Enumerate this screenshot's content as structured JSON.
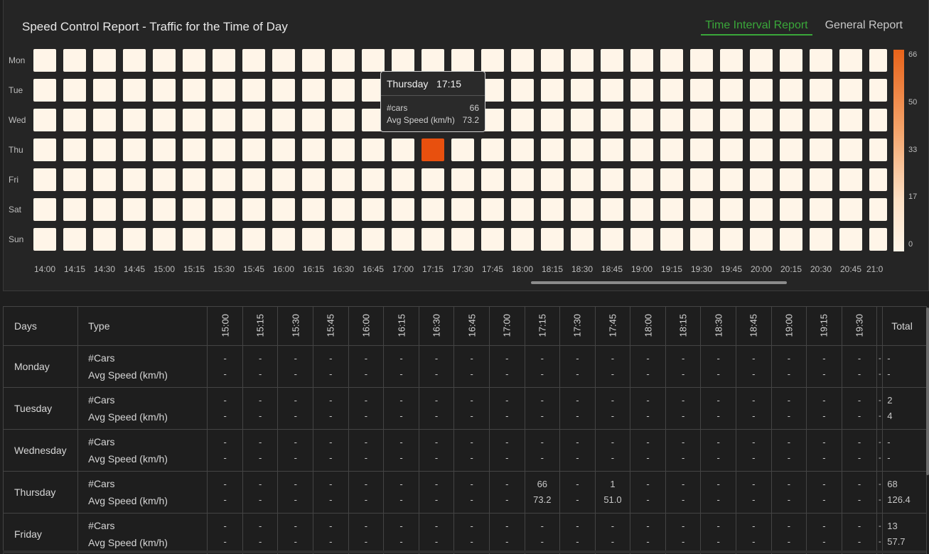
{
  "header": {
    "title": "Speed Control Report - Traffic for the Time of Day",
    "tabs": [
      {
        "label": "Time Interval Report",
        "active": true
      },
      {
        "label": "General Report",
        "active": false
      }
    ]
  },
  "colors": {
    "accent": "#3aa83a",
    "heat_high": "#e8500e",
    "heat_low": "#fff5e8"
  },
  "chart_data": {
    "type": "heatmap",
    "days": [
      "Mon",
      "Tue",
      "Wed",
      "Thu",
      "Fri",
      "Sat",
      "Sun"
    ],
    "times": [
      "14:00",
      "14:15",
      "14:30",
      "14:45",
      "15:00",
      "15:15",
      "15:30",
      "15:45",
      "16:00",
      "16:15",
      "16:30",
      "16:45",
      "17:00",
      "17:15",
      "17:30",
      "17:45",
      "18:00",
      "18:15",
      "18:30",
      "18:45",
      "19:00",
      "19:15",
      "19:30",
      "19:45",
      "20:00",
      "20:15",
      "20:30",
      "20:45",
      "21:0"
    ],
    "values": [
      {
        "day": "Thu",
        "time": "17:15",
        "value": 66
      }
    ],
    "legend_ticks": [
      "66",
      "50",
      "33",
      "17",
      "0"
    ],
    "range": [
      0,
      66
    ]
  },
  "tooltip": {
    "day": "Thursday",
    "time": "17:15",
    "rows": [
      {
        "label": "#cars",
        "value": "66"
      },
      {
        "label": "Avg Speed (km/h)",
        "value": "73.2"
      }
    ]
  },
  "table": {
    "headers": {
      "days": "Days",
      "type": "Type",
      "total": "Total"
    },
    "time_columns": [
      "15:00",
      "15:15",
      "15:30",
      "15:45",
      "16:00",
      "16:15",
      "16:30",
      "16:45",
      "17:00",
      "17:15",
      "17:30",
      "17:45",
      "18:00",
      "18:15",
      "18:30",
      "18:45",
      "19:00",
      "19:15",
      "19:30"
    ],
    "type_labels": [
      "#Cars",
      "Avg Speed (km/h)"
    ],
    "rows": [
      {
        "day": "Monday",
        "cars": [
          "-",
          "-",
          "-",
          "-",
          "-",
          "-",
          "-",
          "-",
          "-",
          "-",
          "-",
          "-",
          "-",
          "-",
          "-",
          "-",
          "-",
          "-",
          "-"
        ],
        "speed": [
          "-",
          "-",
          "-",
          "-",
          "-",
          "-",
          "-",
          "-",
          "-",
          "-",
          "-",
          "-",
          "-",
          "-",
          "-",
          "-",
          "-",
          "-",
          "-"
        ],
        "total_cars": "-",
        "total_speed": "-"
      },
      {
        "day": "Tuesday",
        "cars": [
          "-",
          "-",
          "-",
          "-",
          "-",
          "-",
          "-",
          "-",
          "-",
          "-",
          "-",
          "-",
          "-",
          "-",
          "-",
          "-",
          "-",
          "-",
          "-"
        ],
        "speed": [
          "-",
          "-",
          "-",
          "-",
          "-",
          "-",
          "-",
          "-",
          "-",
          "-",
          "-",
          "-",
          "-",
          "-",
          "-",
          "-",
          "-",
          "-",
          "-"
        ],
        "total_cars": "2",
        "total_speed": "4"
      },
      {
        "day": "Wednesday",
        "cars": [
          "-",
          "-",
          "-",
          "-",
          "-",
          "-",
          "-",
          "-",
          "-",
          "-",
          "-",
          "-",
          "-",
          "-",
          "-",
          "-",
          "-",
          "-",
          "-"
        ],
        "speed": [
          "-",
          "-",
          "-",
          "-",
          "-",
          "-",
          "-",
          "-",
          "-",
          "-",
          "-",
          "-",
          "-",
          "-",
          "-",
          "-",
          "-",
          "-",
          "-"
        ],
        "total_cars": "-",
        "total_speed": "-"
      },
      {
        "day": "Thursday",
        "cars": [
          "-",
          "-",
          "-",
          "-",
          "-",
          "-",
          "-",
          "-",
          "-",
          "66",
          "-",
          "1",
          "-",
          "-",
          "-",
          "-",
          "-",
          "-",
          "-"
        ],
        "speed": [
          "-",
          "-",
          "-",
          "-",
          "-",
          "-",
          "-",
          "-",
          "-",
          "73.2",
          "-",
          "51.0",
          "-",
          "-",
          "-",
          "-",
          "-",
          "-",
          "-"
        ],
        "total_cars": "68",
        "total_speed": "126.4"
      },
      {
        "day": "Friday",
        "cars": [
          "-",
          "-",
          "-",
          "-",
          "-",
          "-",
          "-",
          "-",
          "-",
          "-",
          "-",
          "-",
          "-",
          "-",
          "-",
          "-",
          "-",
          "-",
          "-"
        ],
        "speed": [
          "-",
          "-",
          "-",
          "-",
          "-",
          "-",
          "-",
          "-",
          "-",
          "-",
          "-",
          "-",
          "-",
          "-",
          "-",
          "-",
          "-",
          "-",
          "-"
        ],
        "total_cars": "13",
        "total_speed": "57.7"
      }
    ]
  }
}
